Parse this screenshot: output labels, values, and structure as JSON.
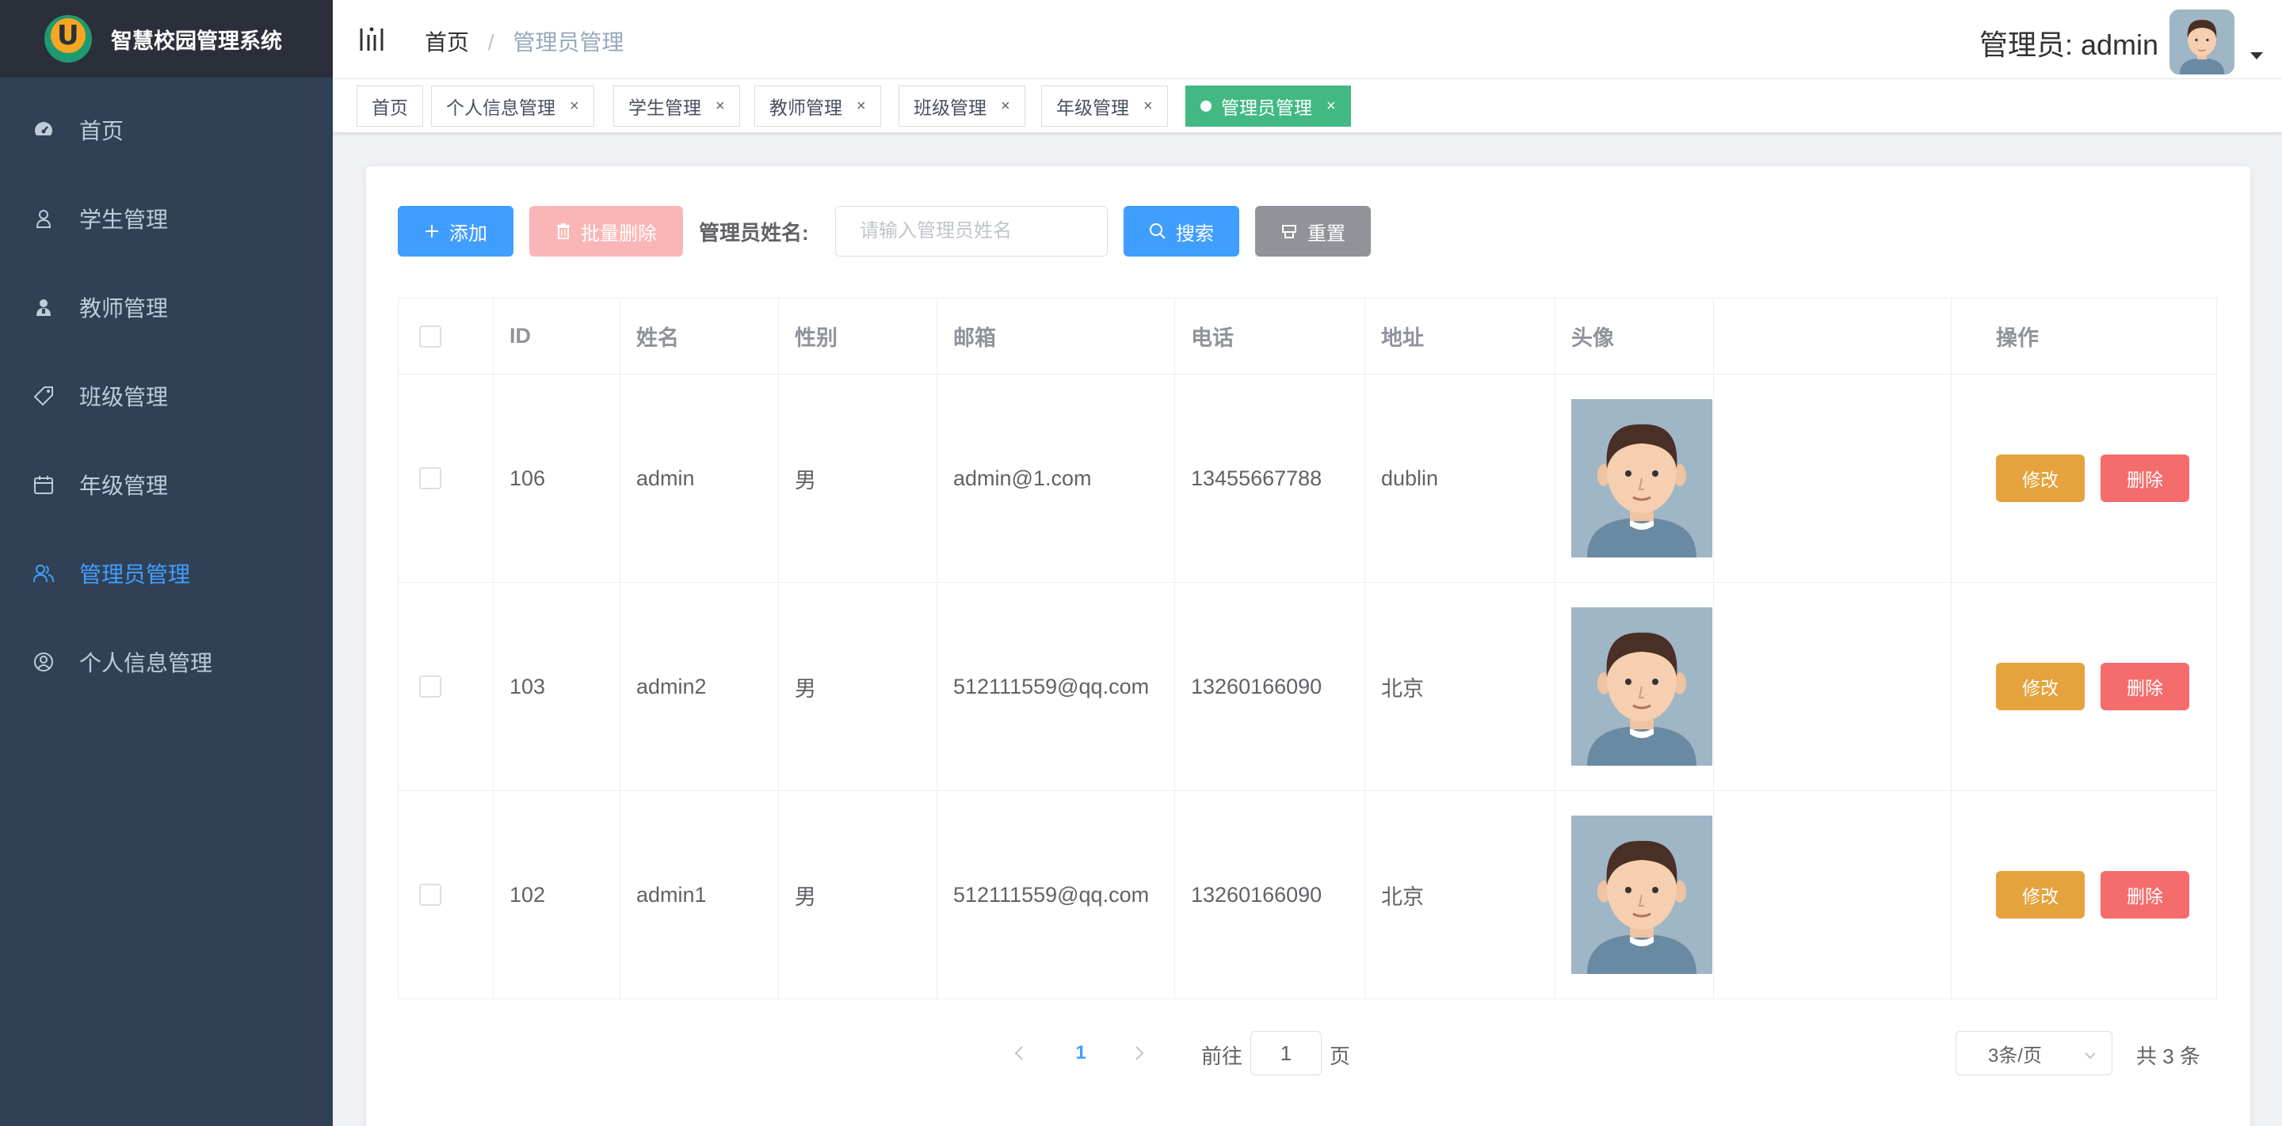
{
  "app": {
    "title": "智慧校园管理系统"
  },
  "sidebar": {
    "items": [
      {
        "label": "首页",
        "icon": "dashboard-icon",
        "active": false
      },
      {
        "label": "学生管理",
        "icon": "user-icon",
        "active": false
      },
      {
        "label": "教师管理",
        "icon": "teacher-icon",
        "active": false
      },
      {
        "label": "班级管理",
        "icon": "tag-icon",
        "active": false
      },
      {
        "label": "年级管理",
        "icon": "calendar-icon",
        "active": false
      },
      {
        "label": "管理员管理",
        "icon": "users-icon",
        "active": true
      },
      {
        "label": "个人信息管理",
        "icon": "profile-icon",
        "active": false
      }
    ]
  },
  "header": {
    "breadcrumb": [
      "首页",
      "管理员管理"
    ],
    "user_label": "管理员: admin"
  },
  "tags": [
    {
      "label": "首页",
      "closable": false,
      "active": false
    },
    {
      "label": "个人信息管理",
      "closable": true,
      "active": false
    },
    {
      "label": "学生管理",
      "closable": true,
      "active": false
    },
    {
      "label": "教师管理",
      "closable": true,
      "active": false
    },
    {
      "label": "班级管理",
      "closable": true,
      "active": false
    },
    {
      "label": "年级管理",
      "closable": true,
      "active": false
    },
    {
      "label": "管理员管理",
      "closable": true,
      "active": true
    }
  ],
  "toolbar": {
    "add_label": "添加",
    "batch_delete_label": "批量删除",
    "search_label": "管理员姓名:",
    "search_placeholder": "请输入管理员姓名",
    "search_value": "",
    "search_button": "搜索",
    "reset_button": "重置"
  },
  "table": {
    "columns": [
      "ID",
      "姓名",
      "性别",
      "邮箱",
      "电话",
      "地址",
      "头像",
      "",
      "操作"
    ],
    "rows": [
      {
        "id": "106",
        "name": "admin",
        "gender": "男",
        "email": "admin@1.com",
        "phone": "13455667788",
        "address": "dublin"
      },
      {
        "id": "103",
        "name": "admin2",
        "gender": "男",
        "email": "512111559@qq.com",
        "phone": "13260166090",
        "address": "北京"
      },
      {
        "id": "102",
        "name": "admin1",
        "gender": "男",
        "email": "512111559@qq.com",
        "phone": "13260166090",
        "address": "北京"
      }
    ],
    "edit_label": "修改",
    "delete_label": "删除"
  },
  "pagination": {
    "current_page": "1",
    "goto_label": "前往",
    "goto_value": "1",
    "goto_unit": "页",
    "page_size": "3条/页",
    "total": "共 3 条"
  },
  "colors": {
    "sidebar_bg": "#304156",
    "brand_bg": "#2b2f3a",
    "primary": "#409eff",
    "active_tag": "#42b983",
    "warning": "#e6a23c",
    "danger": "#f56c6c",
    "info": "#909399"
  }
}
